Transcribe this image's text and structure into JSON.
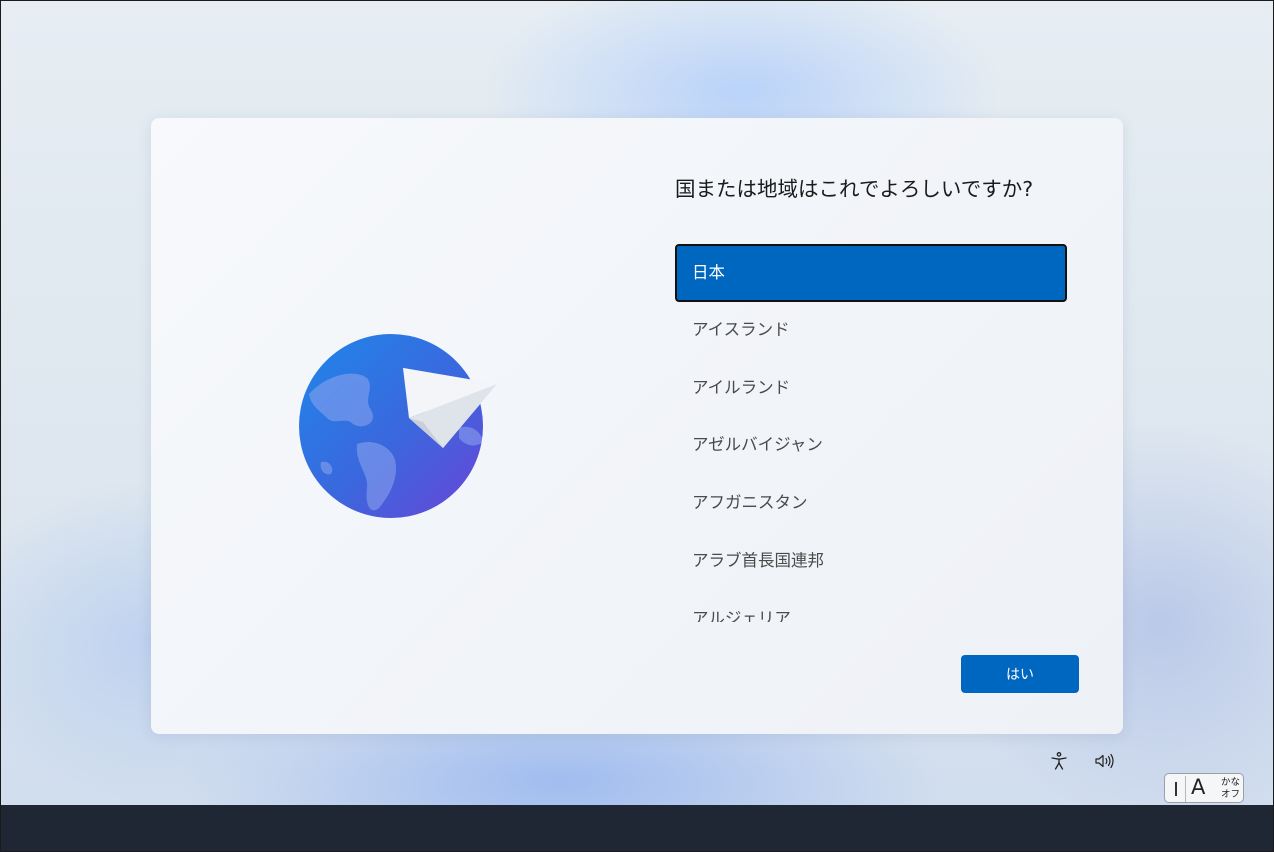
{
  "dialog": {
    "title": "国または地域はこれでよろしいですか?",
    "regions": [
      {
        "label": "日本",
        "selected": true
      },
      {
        "label": "アイスランド",
        "selected": false
      },
      {
        "label": "アイルランド",
        "selected": false
      },
      {
        "label": "アゼルバイジャン",
        "selected": false
      },
      {
        "label": "アフガニスタン",
        "selected": false
      },
      {
        "label": "アラブ首長国連邦",
        "selected": false
      },
      {
        "label": "アルジェリア",
        "selected": false
      }
    ],
    "yes_label": "はい"
  },
  "system": {
    "accessibility_icon": "accessibility-icon",
    "volume_icon": "volume-icon",
    "ime": {
      "mode_letter": "A",
      "line1": "かな",
      "line2": "オフ"
    }
  },
  "colors": {
    "accent": "#0067c0",
    "taskbar": "#202734"
  }
}
